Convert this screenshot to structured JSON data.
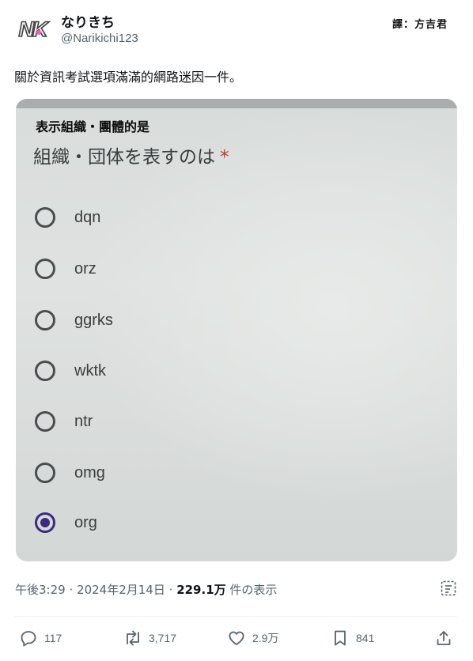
{
  "author": {
    "avatar_text": "NK",
    "display_name": "なりきち",
    "handle": "@Narikichi123"
  },
  "credit": "譯：方吉君",
  "tweet_text": "關於資訊考試選項滿滿的網路迷因一件。",
  "photo": {
    "caption": "表示組織・團體的是",
    "question": "組織・団体を表すのは",
    "required_mark": "*",
    "options": [
      {
        "label": "dqn",
        "selected": false
      },
      {
        "label": "orz",
        "selected": false
      },
      {
        "label": "ggrks",
        "selected": false
      },
      {
        "label": "wktk",
        "selected": false
      },
      {
        "label": "ntr",
        "selected": false
      },
      {
        "label": "omg",
        "selected": false
      },
      {
        "label": "org",
        "selected": true
      }
    ]
  },
  "meta": {
    "time": "午後3:29",
    "separator": "·",
    "date": "2024年2月14日",
    "views_count": "229.1万",
    "views_label": "件の表示"
  },
  "actions": {
    "replies": "117",
    "reposts": "3,717",
    "likes": "2.9万",
    "bookmarks": "841"
  },
  "colors": {
    "text": "#0f1419",
    "secondary": "#536471",
    "radio_selected": "#3b2a7e",
    "required": "#c0392b"
  }
}
